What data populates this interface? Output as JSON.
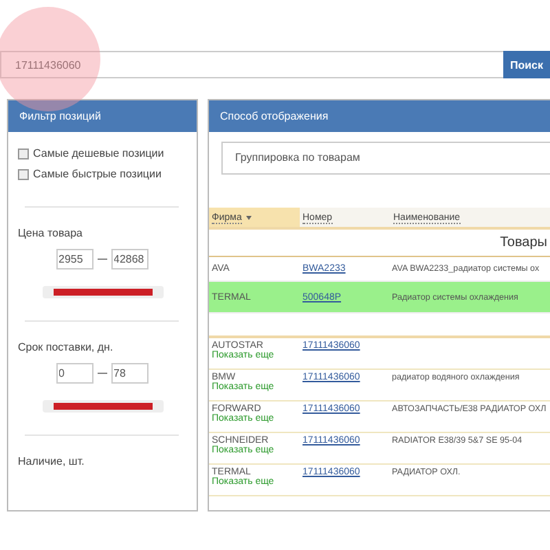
{
  "search": {
    "value": "17111436060",
    "button": "Поиск"
  },
  "filter": {
    "title": "Фильтр позиций",
    "checkboxes": [
      {
        "label": "Самые дешевые позиции",
        "checked": false
      },
      {
        "label": "Самые быстрые позиции",
        "checked": false
      }
    ],
    "ranges": [
      {
        "label": "Цена товара",
        "from": "2955",
        "to": "42868",
        "level": 1
      },
      {
        "label": "Срок поставки, дн.",
        "from": "0",
        "to": "78",
        "level": 1
      }
    ],
    "next_section": "Наличие, шт."
  },
  "display": {
    "title": "Способ отображения",
    "mode": "Группировка по товарам"
  },
  "table": {
    "columns": [
      {
        "label": "Фирма",
        "sorted": true
      },
      {
        "label": "Номер",
        "sorted": false
      },
      {
        "label": "Наименование",
        "sorted": false
      }
    ],
    "group": "Товары",
    "rows": [
      {
        "brand": "AVA",
        "number": "BWA2233",
        "name": "AVA BWA2233_радиатор системы ох",
        "selected": false
      },
      {
        "brand": "TERMAL",
        "number": "500648P",
        "name": "Радиатор системы охлаждения",
        "selected": true
      }
    ],
    "more_rows": [
      {
        "brand": "AUTOSTAR",
        "more": "Показать еще",
        "number": "17111436060",
        "name": ""
      },
      {
        "brand": "BMW",
        "more": "Показать еще",
        "number": "17111436060",
        "name": "радиатор водяного охлаждения"
      },
      {
        "brand": "FORWARD",
        "more": "Показать еще",
        "number": "17111436060",
        "name": "АВТОЗАПЧАСТЬ/E38 РАДИАТОР ОХЛ"
      },
      {
        "brand": "SCHNEIDER",
        "more": "Показать еще",
        "number": "17111436060",
        "name": "RADIATOR E38/39 5&7 SE 95-04"
      },
      {
        "brand": "TERMAL",
        "more": "Показать еще",
        "number": "17111436060",
        "name": "РАДИАТОР ОХЛ."
      }
    ]
  }
}
